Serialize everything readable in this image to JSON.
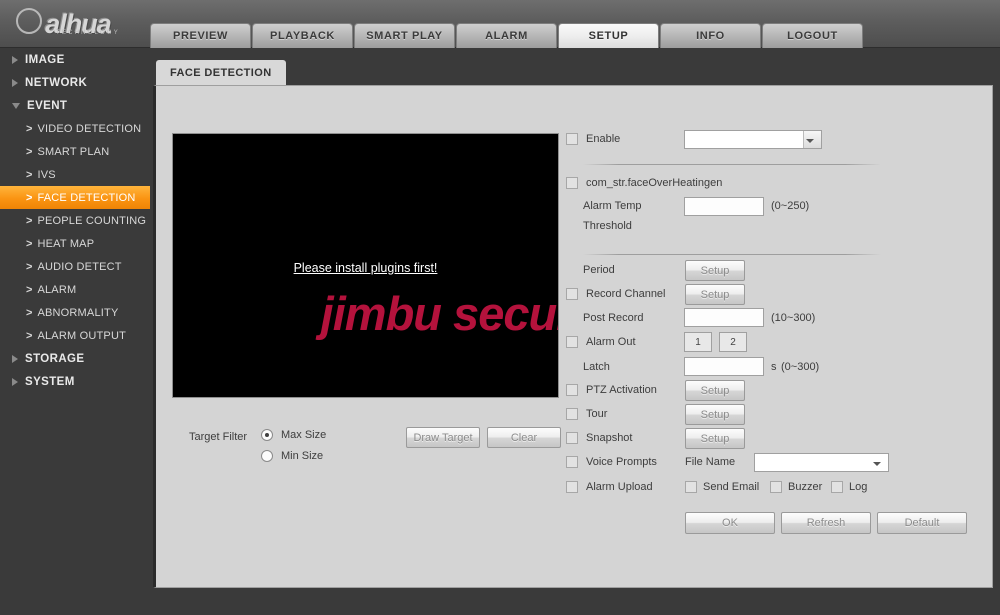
{
  "brand": {
    "name": "alhua",
    "tagline": "TECHNOLOGY"
  },
  "topnav": {
    "items": [
      {
        "label": "PREVIEW",
        "active": false
      },
      {
        "label": "PLAYBACK",
        "active": false
      },
      {
        "label": "SMART PLAY",
        "active": false
      },
      {
        "label": "ALARM",
        "active": false
      },
      {
        "label": "SETUP",
        "active": true
      },
      {
        "label": "INFO",
        "active": false
      },
      {
        "label": "LOGOUT",
        "active": false
      }
    ]
  },
  "sidebar": {
    "groups": [
      {
        "label": "IMAGE",
        "expanded": false
      },
      {
        "label": "NETWORK",
        "expanded": false
      },
      {
        "label": "EVENT",
        "expanded": true
      }
    ],
    "event_items": [
      {
        "label": "VIDEO DETECTION",
        "active": false
      },
      {
        "label": "SMART PLAN",
        "active": false
      },
      {
        "label": "IVS",
        "active": false
      },
      {
        "label": "FACE DETECTION",
        "active": true
      },
      {
        "label": "PEOPLE COUNTING",
        "active": false
      },
      {
        "label": "HEAT MAP",
        "active": false
      },
      {
        "label": "AUDIO DETECT",
        "active": false
      },
      {
        "label": "ALARM",
        "active": false
      },
      {
        "label": "ABNORMALITY",
        "active": false
      },
      {
        "label": "ALARM OUTPUT",
        "active": false
      }
    ],
    "tail_groups": [
      {
        "label": "STORAGE",
        "expanded": false
      },
      {
        "label": "SYSTEM",
        "expanded": false
      }
    ],
    "chevron": ">"
  },
  "content_tab": {
    "label": "FACE DETECTION"
  },
  "video": {
    "plugin_message": "Please install plugins first!",
    "watermark": "jimbu security"
  },
  "target_filter": {
    "label": "Target Filter",
    "max_size": "Max Size",
    "min_size": "Min Size",
    "selected": "Max Size",
    "draw_target": "Draw Target",
    "clear": "Clear"
  },
  "settings": {
    "enable": {
      "label": "Enable",
      "checked": false,
      "dropdown_value": ""
    },
    "over_heating": {
      "label": "com_str.faceOverHeatingen",
      "checked": false
    },
    "alarm_temp_threshold": {
      "label_line1": "Alarm Temp",
      "label_line2": "Threshold",
      "value": "",
      "range": "(0~250)"
    },
    "period": {
      "label": "Period",
      "button": "Setup"
    },
    "record_channel": {
      "label": "Record Channel",
      "checked": false,
      "button": "Setup"
    },
    "post_record": {
      "label": "Post Record",
      "value": "",
      "range": "(10~300)"
    },
    "alarm_out": {
      "label": "Alarm Out",
      "checked": false,
      "channels": [
        "1",
        "2"
      ]
    },
    "latch": {
      "label": "Latch",
      "value": "",
      "unit": "s",
      "range": "(0~300)"
    },
    "ptz_activation": {
      "label": "PTZ Activation",
      "checked": false,
      "button": "Setup"
    },
    "tour": {
      "label": "Tour",
      "checked": false,
      "button": "Setup"
    },
    "snapshot": {
      "label": "Snapshot",
      "checked": false,
      "button": "Setup"
    },
    "voice_prompts": {
      "label": "Voice Prompts",
      "checked": false
    },
    "file_name": {
      "label": "File Name",
      "value": ""
    },
    "alarm_upload": {
      "label": "Alarm Upload",
      "checked": false
    },
    "send_email": {
      "label": "Send Email",
      "checked": false
    },
    "buzzer": {
      "label": "Buzzer",
      "checked": false
    },
    "log": {
      "label": "Log",
      "checked": false
    }
  },
  "actions": {
    "ok": "OK",
    "refresh": "Refresh",
    "default": "Default"
  },
  "colors": {
    "accent": "#fa9412",
    "watermark": "#b4123c",
    "panel_bg": "#d4d4d4",
    "chrome": "#3a3a3a"
  }
}
